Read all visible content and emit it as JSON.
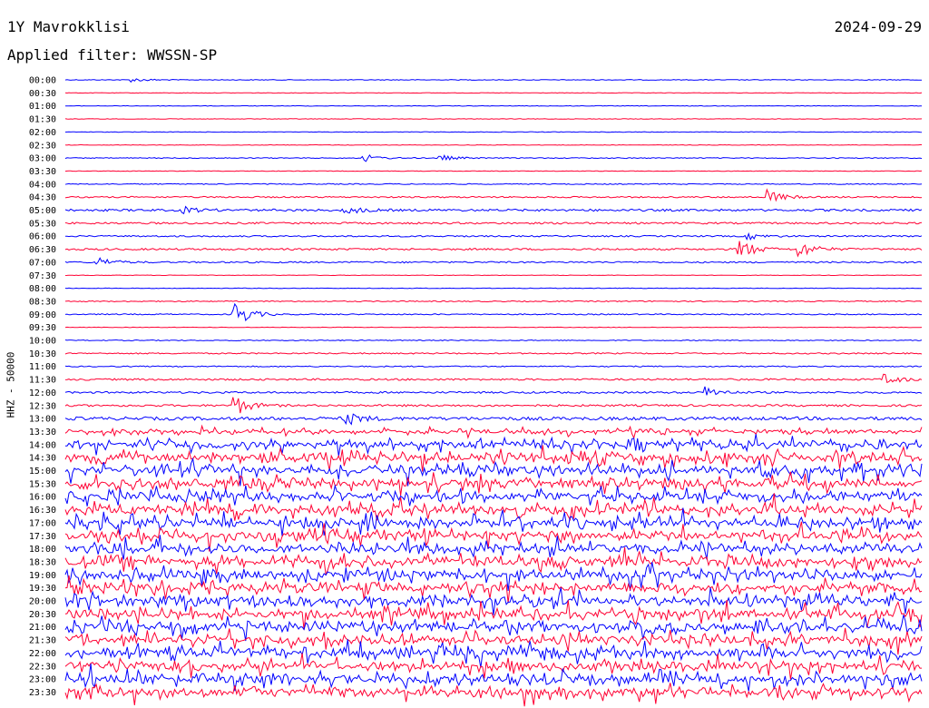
{
  "header": {
    "station": "1Y Mavrokklisi",
    "date": "2024-09-29",
    "filter": "Applied filter: WWSSN-SP"
  },
  "chart_data": {
    "type": "line",
    "title": "1Y Mavrokklisi",
    "date": "2024-09-29",
    "ylabel": "HHZ - 50000",
    "row_labels": [
      "00:00",
      "00:30",
      "01:00",
      "01:30",
      "02:00",
      "02:30",
      "03:00",
      "03:30",
      "04:00",
      "04:30",
      "05:00",
      "05:30",
      "06:00",
      "06:30",
      "07:00",
      "07:30",
      "08:00",
      "08:30",
      "09:00",
      "09:30",
      "10:00",
      "10:30",
      "11:00",
      "11:30",
      "12:00",
      "12:30",
      "13:00",
      "13:30",
      "14:00",
      "14:30",
      "15:00",
      "15:30",
      "16:00",
      "16:30",
      "17:00",
      "17:30",
      "18:00",
      "18:30",
      "19:00",
      "19:30",
      "20:00",
      "20:30",
      "21:00",
      "21:30",
      "22:00",
      "22:30",
      "23:00",
      "23:30"
    ],
    "trace_colors": [
      "#0000ff",
      "#ff0033"
    ],
    "noise_level": [
      0.4,
      0.3,
      0.3,
      0.3,
      0.3,
      0.3,
      0.5,
      0.3,
      0.5,
      0.8,
      1.2,
      1.0,
      0.8,
      1.0,
      0.8,
      0.3,
      0.3,
      0.6,
      0.6,
      0.3,
      0.5,
      0.7,
      0.6,
      1.0,
      1.0,
      1.1,
      1.8,
      2.5,
      5,
      6,
      6,
      6,
      6,
      6,
      6,
      6,
      6,
      6,
      6,
      6,
      6,
      6,
      6,
      6,
      6,
      6,
      6,
      6
    ],
    "events": [
      {
        "row": 0,
        "t": 0.08,
        "amp": 2
      },
      {
        "row": 6,
        "t": 0.35,
        "amp": 4
      },
      {
        "row": 6,
        "t": 0.44,
        "amp": 3
      },
      {
        "row": 9,
        "t": 0.82,
        "amp": 8
      },
      {
        "row": 10,
        "t": 0.33,
        "amp": 4
      },
      {
        "row": 10,
        "t": 0.14,
        "amp": 3
      },
      {
        "row": 12,
        "t": 0.8,
        "amp": 3
      },
      {
        "row": 13,
        "t": 0.79,
        "amp": 10
      },
      {
        "row": 13,
        "t": 0.86,
        "amp": 8
      },
      {
        "row": 14,
        "t": 0.04,
        "amp": 5
      },
      {
        "row": 18,
        "t": 0.2,
        "amp": 14
      },
      {
        "row": 25,
        "t": 0.2,
        "amp": 10
      },
      {
        "row": 24,
        "t": 0.75,
        "amp": 6
      },
      {
        "row": 26,
        "t": 0.33,
        "amp": 6
      },
      {
        "row": 23,
        "t": 0.96,
        "amp": 5
      }
    ]
  }
}
